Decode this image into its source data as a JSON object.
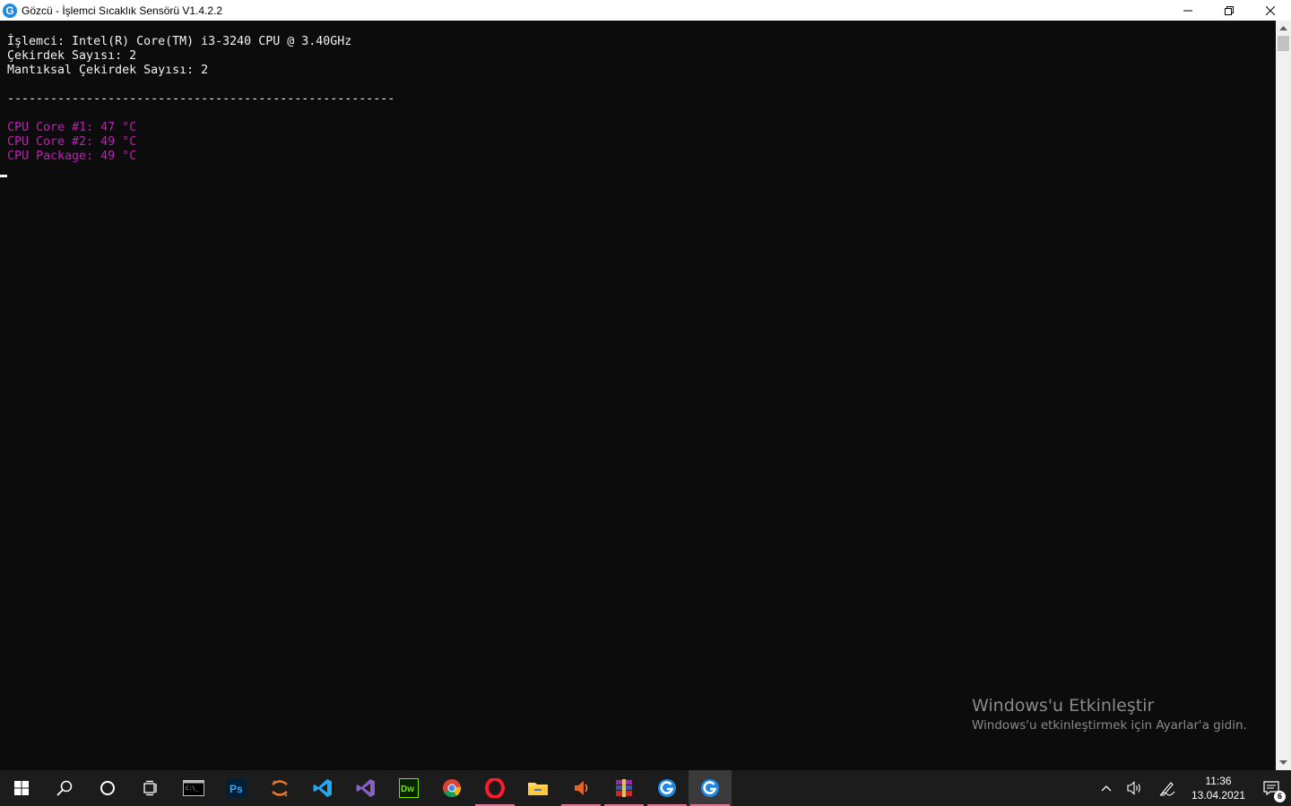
{
  "window": {
    "title": "Gözcü - İşlemci Sıcaklık Sensörü V1.4.2.2",
    "icon_letter": "G"
  },
  "console": {
    "info_lines": [
      "İşlemci: Intel(R) Core(TM) i3-3240 CPU @ 3.40GHz",
      "Çekirdek Sayısı: 2",
      "Mantıksal Çekirdek Sayısı: 2"
    ],
    "separator": "------------------------------------------------------",
    "temp_lines": [
      "CPU Core #1: 47 °C",
      "CPU Core #2: 49 °C",
      "CPU Package: 49 °C"
    ]
  },
  "watermark": {
    "title": "Windows'u Etkinleştir",
    "subtitle": "Windows'u etkinleştirmek için Ayarlar'a gidin."
  },
  "taskbar": {
    "clock_time": "11:36",
    "clock_date": "13.04.2021",
    "notification_count": "6",
    "ps_label": "Ps",
    "dw_label": "Dw"
  },
  "colors": {
    "console_bg": "#0c0c0c",
    "console_text": "#f2f2f2",
    "temp_text": "#c41ab9",
    "taskbar_bg": "#1c1c1c",
    "running_indicator": "#e57399"
  }
}
